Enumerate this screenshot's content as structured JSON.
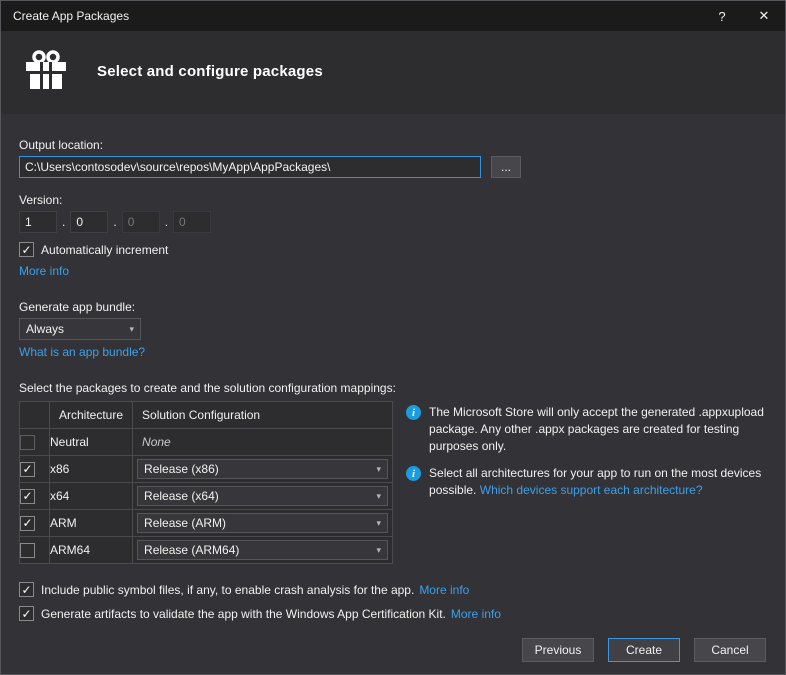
{
  "window": {
    "title": "Create App Packages",
    "help_label": "?",
    "close_label": "✕"
  },
  "header": {
    "title": "Select and configure packages"
  },
  "icons": {
    "chevron": "▾",
    "check": "✓",
    "info": "i"
  },
  "output": {
    "label": "Output location:",
    "value": "C:\\Users\\contosodev\\source\\repos\\MyApp\\AppPackages\\",
    "browse_label": "..."
  },
  "version": {
    "label": "Version:",
    "separator": ".",
    "parts": [
      "1",
      "0",
      "0",
      "0"
    ],
    "auto_increment": {
      "label": "Automatically increment",
      "checked": true
    },
    "more_info_label": "More info"
  },
  "bundle": {
    "label": "Generate app bundle:",
    "value": "Always",
    "link": "What is an app bundle?"
  },
  "packages": {
    "label": "Select the packages to create and the solution configuration mappings:",
    "columns": {
      "architecture": "Architecture",
      "configuration": "Solution Configuration"
    },
    "rows": [
      {
        "arch": "Neutral",
        "config": "None",
        "checked": false
      },
      {
        "arch": "x86",
        "config": "Release (x86)",
        "checked": true
      },
      {
        "arch": "x64",
        "config": "Release (x64)",
        "checked": true
      },
      {
        "arch": "ARM",
        "config": "Release (ARM)",
        "checked": true
      },
      {
        "arch": "ARM64",
        "config": "Release (ARM64)",
        "checked": false
      }
    ]
  },
  "notes": [
    {
      "text": "The Microsoft Store will only accept the generated .appxupload package. Any other .appx packages are created for testing purposes only.",
      "link": ""
    },
    {
      "text": "Select all architectures for your app to run on the most devices possible.",
      "link": "Which devices support each architecture?"
    }
  ],
  "options": [
    {
      "text": "Include public symbol files, if any, to enable crash analysis for the app.",
      "link": "More info",
      "checked": true
    },
    {
      "text": "Generate artifacts to validate the app with the Windows App Certification Kit.",
      "link": "More info",
      "checked": true
    }
  ],
  "footer": {
    "previous_label": "Previous",
    "create_label": "Create",
    "cancel_label": "Cancel"
  },
  "colors": {
    "accent": "#007acc",
    "link": "#3ba0e8",
    "info_icon": "#1a9ddf"
  }
}
